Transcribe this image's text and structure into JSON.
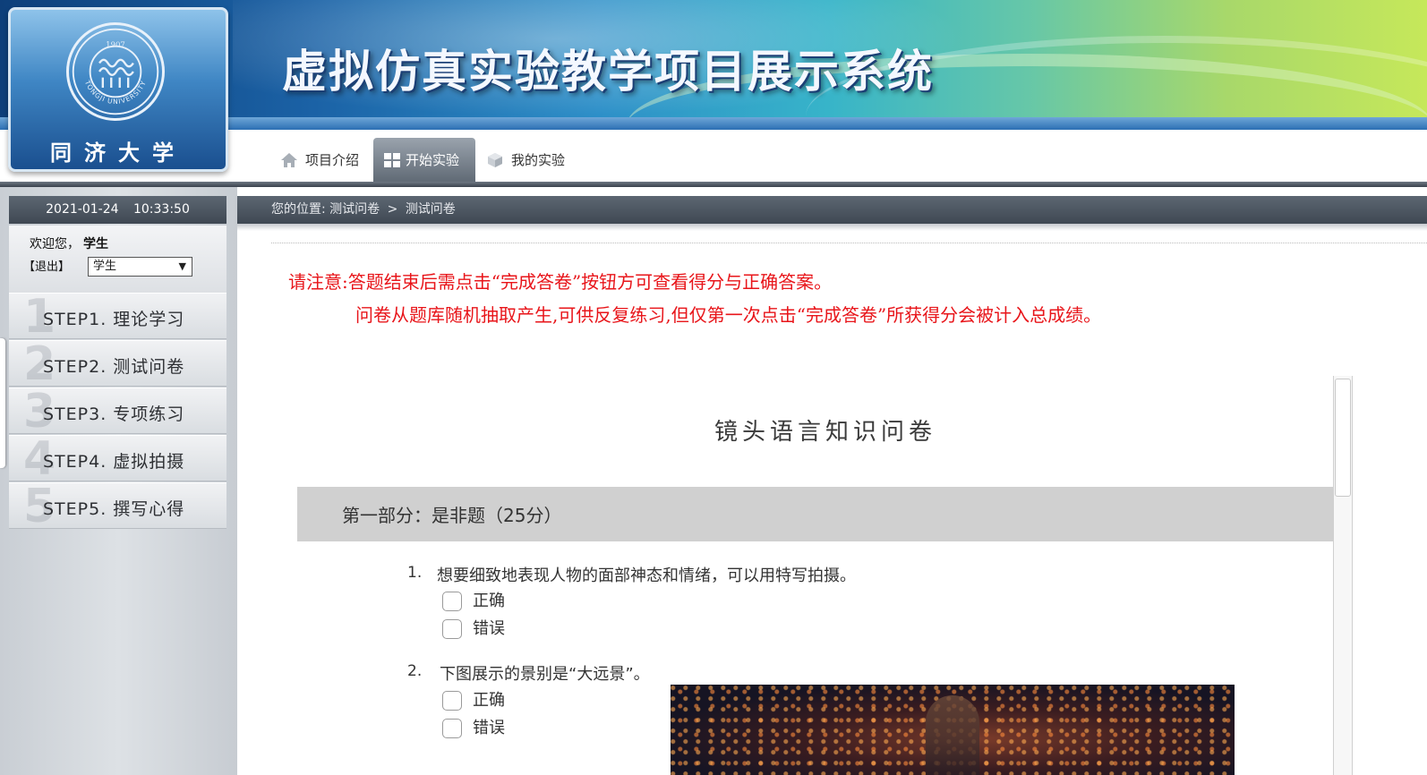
{
  "header": {
    "site_title": "虚拟仿真实验教学项目展示系统",
    "logo_text": "同济大学",
    "logo_seal_text": "TONGJI UNIVERSITY",
    "logo_seal_year": "1907"
  },
  "nav": {
    "items": [
      {
        "label": "项目介绍",
        "icon": "home-icon",
        "active": false
      },
      {
        "label": "开始实验",
        "icon": "grid-icon",
        "active": true
      },
      {
        "label": "我的实验",
        "icon": "cube-icon",
        "active": false
      }
    ]
  },
  "sidebar": {
    "date": "2021-01-24",
    "time": "10:33:50",
    "welcome_prefix": "欢迎您，",
    "user_name": "学生",
    "logout_label": "【退出】",
    "role_selected": "学生",
    "steps": [
      {
        "num": "1",
        "label": "STEP1. 理论学习"
      },
      {
        "num": "2",
        "label": "STEP2. 测试问卷"
      },
      {
        "num": "3",
        "label": "STEP3. 专项练习"
      },
      {
        "num": "4",
        "label": "STEP4. 虚拟拍摄"
      },
      {
        "num": "5",
        "label": "STEP5. 撰写心得"
      }
    ]
  },
  "breadcrumb": {
    "prefix": "您的位置:",
    "item1": "测试问卷",
    "separator": ">",
    "item2": "测试问卷"
  },
  "notice": {
    "line1": "请注意:答题结束后需点击“完成答卷”按钮方可查看得分与正确答案。",
    "line2": "问卷从题库随机抽取产生,可供反复练习,但仅第一次点击“完成答卷”所获得分会被计入总成绩。"
  },
  "quiz": {
    "title": "镜头语言知识问卷",
    "section_title": "第一部分：是非题（25分）",
    "questions": [
      {
        "num": "1.",
        "text": "想要细致地表现人物的面部神态和情绪，可以用特写拍摄。",
        "options": [
          "正确",
          "错误"
        ]
      },
      {
        "num": "2.",
        "text": "下图展示的景别是“大远景”。",
        "options": [
          "正确",
          "错误"
        ]
      }
    ]
  },
  "colors": {
    "notice": "#e8151a",
    "dark_bar": "#4a535e",
    "section_bg": "#d0d0d0"
  }
}
